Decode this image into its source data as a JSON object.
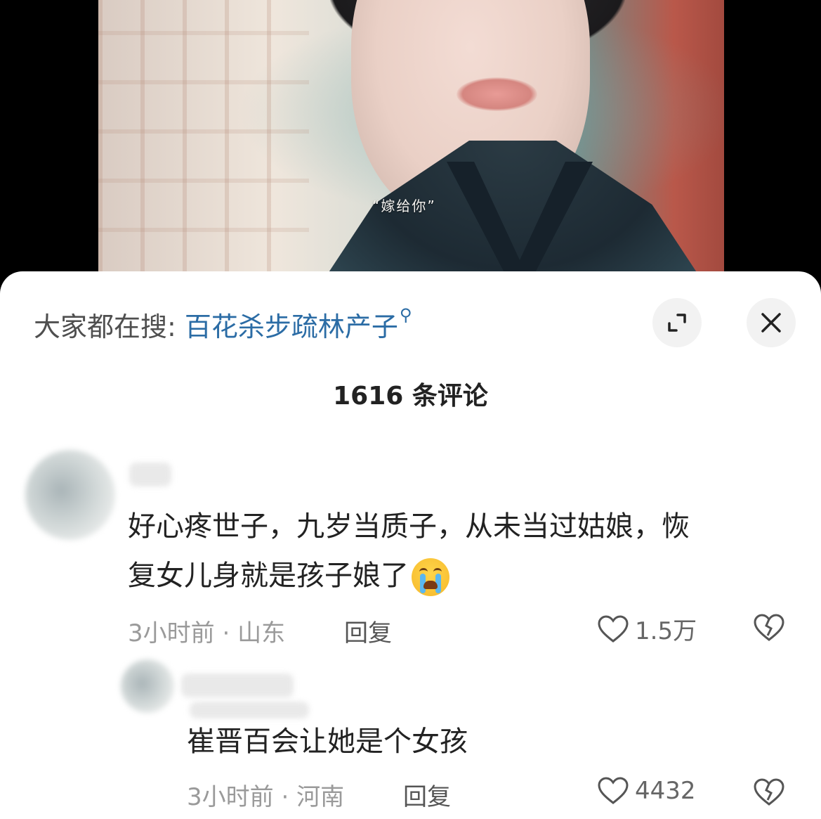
{
  "video": {
    "subtitle": "“嫁给你”"
  },
  "sheet": {
    "search_prefix": "大家都在搜: ",
    "search_term": "百花杀步疏林产子",
    "comment_count": "1616 条评论"
  },
  "comments": [
    {
      "text_line1": "好心疼世子，九岁当质子，从未当过姑娘，恢",
      "text_line2": "复女儿身就是孩子娘了",
      "time": "3小时前",
      "location": "山东",
      "reply_label": "回复",
      "likes": "1.5万"
    },
    {
      "text": "崔晋百会让她是个女孩",
      "time": "3小时前",
      "location": "河南",
      "reply_label": "回复",
      "likes": "4432"
    }
  ],
  "separator": " · ",
  "colors": {
    "link": "#2b6ca5",
    "muted": "#9a9a9a",
    "text": "#222222"
  }
}
